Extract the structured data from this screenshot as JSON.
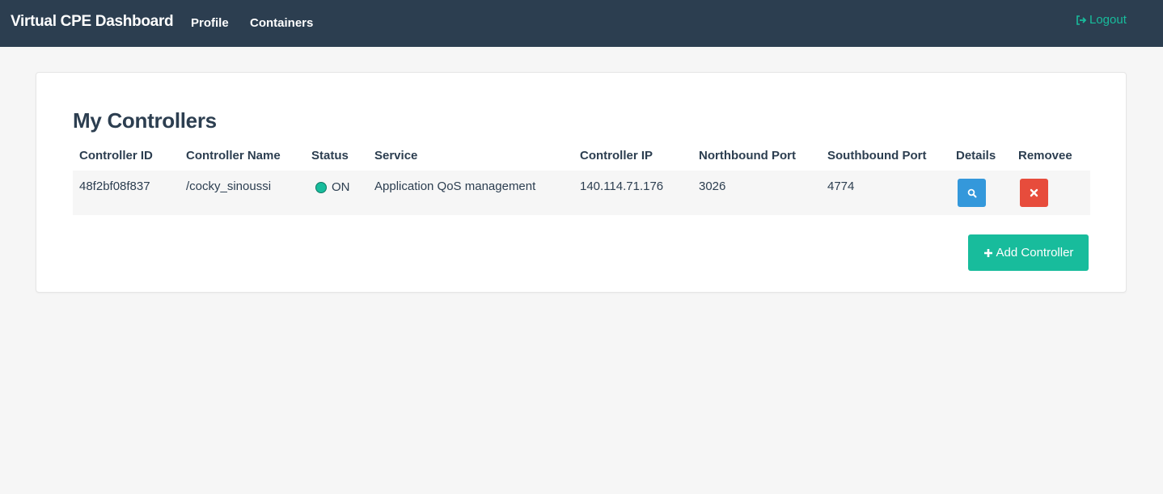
{
  "navbar": {
    "brand": "Virtual CPE Dashboard",
    "links": [
      {
        "label": "Profile"
      },
      {
        "label": "Containers"
      }
    ],
    "logout_label": "Logout",
    "logout_icon": "sign-out-icon",
    "accent_color": "#18bc9c",
    "background_color": "#2c3e50"
  },
  "panel": {
    "title": "My Controllers",
    "columns": [
      "Controller ID",
      "Controller Name",
      "Status",
      "Service",
      "Controller IP",
      "Northbound Port",
      "Southbound Port",
      "Details",
      "Removee"
    ],
    "rows": [
      {
        "id": "48f2bf08f837",
        "name": "/cocky_sinoussi",
        "status": "ON",
        "status_color": "#18bc9c",
        "service": "Application QoS management",
        "ip": "140.114.71.176",
        "northbound_port": "3026",
        "southbound_port": "4774",
        "details_icon": "search-icon",
        "details_color": "#3498db",
        "remove_icon": "close-icon",
        "remove_color": "#e74c3c"
      }
    ],
    "add_button": {
      "label": "Add Controller",
      "icon": "plus-icon",
      "color": "#18bc9c"
    }
  }
}
